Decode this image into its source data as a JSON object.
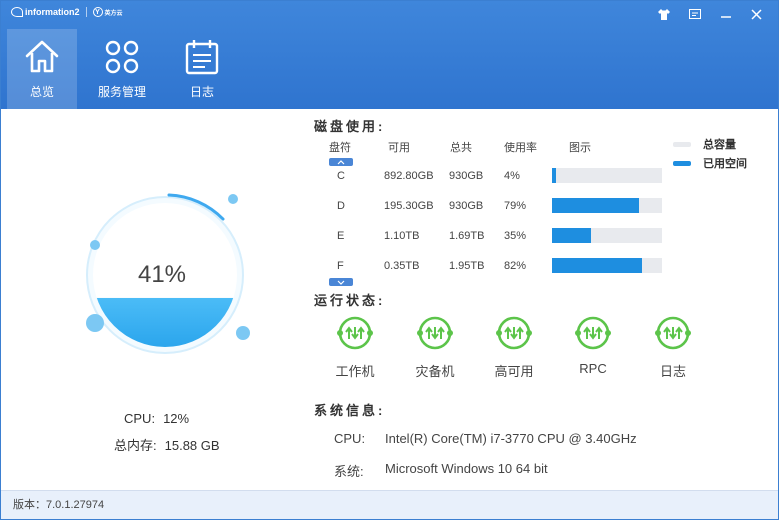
{
  "titlebar": {
    "brand_text": "information2",
    "brand2_text": "英方云",
    "buttons": [
      "shirt-icon",
      "restore-icon",
      "minimize-icon",
      "close-icon"
    ]
  },
  "nav": {
    "tabs": [
      {
        "label": "总览",
        "icon": "home-icon",
        "active": true
      },
      {
        "label": "服务管理",
        "icon": "grid-icon",
        "active": false
      },
      {
        "label": "日志",
        "icon": "calendar-icon",
        "active": false
      }
    ]
  },
  "gauge": {
    "percent_label": "41%",
    "fill_fraction": 0.41,
    "colors": {
      "fill": "#29a8f2",
      "ring": "#cfe9fb",
      "accent": "#3fa9ef"
    }
  },
  "stats": {
    "cpu_label": "CPU:",
    "cpu_value": "12%",
    "mem_label": "总内存:",
    "mem_value": "15.88 GB"
  },
  "disk": {
    "title": "磁盘使用:",
    "headers": [
      "盘符",
      "可用",
      "总共",
      "使用率",
      "图示"
    ],
    "rows": [
      {
        "drive": "C",
        "free": "892.80GB",
        "total": "930GB",
        "usage": "4%",
        "usage_fraction": 0.04
      },
      {
        "drive": "D",
        "free": "195.30GB",
        "total": "930GB",
        "usage": "79%",
        "usage_fraction": 0.79
      },
      {
        "drive": "E",
        "free": "1.10TB",
        "total": "1.69TB",
        "usage": "35%",
        "usage_fraction": 0.35
      },
      {
        "drive": "F",
        "free": "0.35TB",
        "total": "1.95TB",
        "usage": "82%",
        "usage_fraction": 0.82
      }
    ],
    "legend": [
      {
        "label": "总容量",
        "color": "#e8eaee"
      },
      {
        "label": "已用空间",
        "color": "#1e8ee0"
      }
    ]
  },
  "status": {
    "title": "运行状态:",
    "items": [
      "工作机",
      "灾备机",
      "高可用",
      "RPC",
      "日志"
    ],
    "color": "#5cc44a"
  },
  "sysinfo": {
    "title": "系统信息:",
    "cpu_label": "CPU:",
    "cpu_value": "Intel(R) Core(TM) i7-3770 CPU @ 3.40GHz",
    "os_label": "系统:",
    "os_value": "Microsoft Windows 10 64 bit"
  },
  "footer": {
    "version_text": "版本：7.0.1.27974"
  }
}
